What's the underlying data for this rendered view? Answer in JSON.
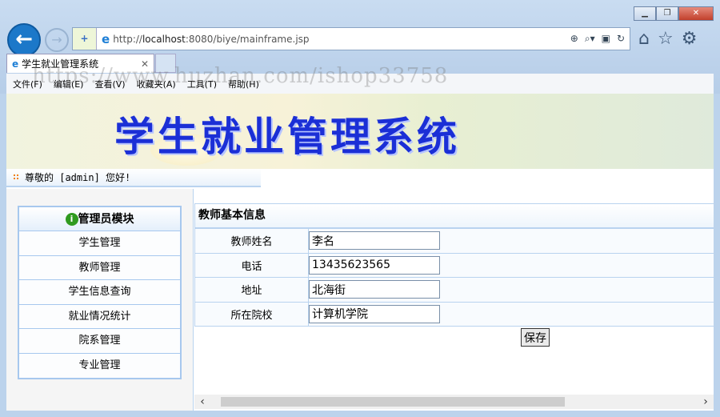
{
  "browser": {
    "url_prefix": "http://",
    "url_host": "localhost",
    "url_rest": ":8080/biye/mainframe.jsp",
    "tab_title": "学生就业管理系统",
    "menu": [
      "文件(F)",
      "编辑(E)",
      "查看(V)",
      "收藏夹(A)",
      "工具(T)",
      "帮助(H)"
    ]
  },
  "watermark": "https://www.huzhan.com/ishop33758",
  "banner": {
    "title": "学生就业管理系统"
  },
  "welcome": "尊敬的 [admin] 您好!",
  "sidebar": {
    "header": "管理员模块",
    "items": [
      "学生管理",
      "教师管理",
      "学生信息查询",
      "就业情况统计",
      "院系管理",
      "专业管理"
    ]
  },
  "form": {
    "title": "教师基本信息",
    "fields": [
      {
        "label": "教师姓名",
        "value": "李名"
      },
      {
        "label": "电话",
        "value": "13435623565"
      },
      {
        "label": "地址",
        "value": "北海街"
      },
      {
        "label": "所在院校",
        "value": "计算机学院"
      }
    ],
    "save_label": "保存"
  }
}
